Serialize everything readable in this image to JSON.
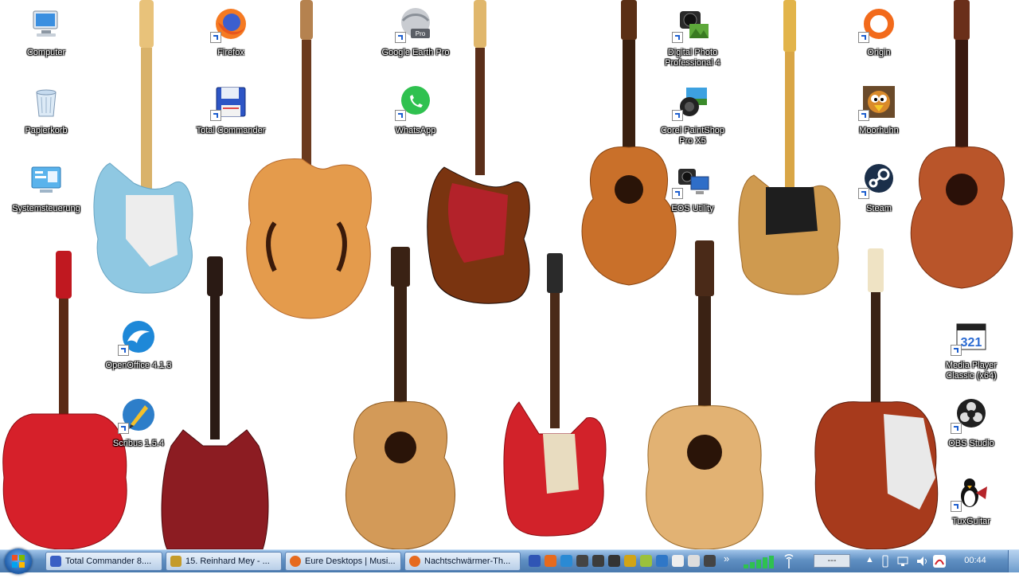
{
  "desktop_icons": [
    {
      "label": "Computer",
      "icon": "computer-icon"
    },
    {
      "label": "Papierkorb",
      "icon": "recycle-bin-icon"
    },
    {
      "label": "Systemsteuerung",
      "icon": "control-panel-icon"
    },
    {
      "label": "Firefox",
      "icon": "firefox-icon"
    },
    {
      "label": "Total Commander",
      "icon": "floppy-icon"
    },
    {
      "label": "OpenOffice 4.1.3",
      "icon": "openoffice-icon"
    },
    {
      "label": "Scribus 1.5.4",
      "icon": "scribus-icon"
    },
    {
      "label": "Google Earth Pro",
      "icon": "google-earth-icon"
    },
    {
      "label": "WhatsApp",
      "icon": "whatsapp-icon"
    },
    {
      "label": "Digital Photo Professional 4",
      "icon": "camera-icon"
    },
    {
      "label": "Corel PaintShop Pro X5",
      "icon": "paintshop-icon"
    },
    {
      "label": "EOS Utility",
      "icon": "eos-utility-icon"
    },
    {
      "label": "Origin",
      "icon": "origin-icon"
    },
    {
      "label": "Moorhuhn",
      "icon": "moorhuhn-icon"
    },
    {
      "label": "Steam",
      "icon": "steam-icon"
    },
    {
      "label": "Media Player Classic (x64)",
      "icon": "media-player-icon"
    },
    {
      "label": "OBS Studio",
      "icon": "obs-icon"
    },
    {
      "label": "TuxGuitar",
      "icon": "tux-icon"
    }
  ],
  "taskbar": {
    "windows": [
      {
        "label": "Total Commander 8....",
        "icon": "floppy-icon",
        "color": "#3a5fc4"
      },
      {
        "label": "15. Reinhard Mey - ...",
        "icon": "music-icon",
        "color": "#c49b2a"
      },
      {
        "label": "Eure Desktops | Musi...",
        "icon": "firefox-icon",
        "color": "#e66a1e"
      },
      {
        "label": "Nachtschwärmer-Th...",
        "icon": "firefox-icon",
        "color": "#e66a1e"
      }
    ],
    "quicklaunch_colors": [
      "#2f55b5",
      "#e66a1e",
      "#2a8ad4",
      "#444444",
      "#3c3c3c",
      "#333333",
      "#d1a416",
      "#9bc13d",
      "#2f77c7",
      "#eeeeee",
      "#dddddd",
      "#444444"
    ],
    "more_indicator": "»",
    "input_box": "---",
    "clock": "00:44"
  },
  "colors": {
    "accent": "#1e5fcf",
    "taskbar": "#5f8fc2"
  }
}
